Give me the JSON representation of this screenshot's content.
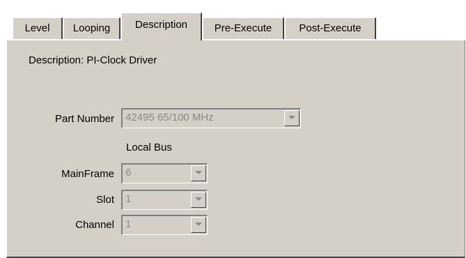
{
  "tabs": [
    {
      "label": "Level",
      "active": false
    },
    {
      "label": "Looping",
      "active": false
    },
    {
      "label": "Description",
      "active": true
    },
    {
      "label": "Pre-Execute",
      "active": false
    },
    {
      "label": "Post-Execute",
      "active": false
    }
  ],
  "description": {
    "label": "Description:",
    "value": "PI-Clock Driver"
  },
  "part_number": {
    "label": "Part Number",
    "value": "42495 65/100 MHz"
  },
  "local_bus": {
    "heading": "Local Bus",
    "mainframe": {
      "label": "MainFrame",
      "value": "6"
    },
    "slot": {
      "label": "Slot",
      "value": "1"
    },
    "channel": {
      "label": "Channel",
      "value": "1"
    }
  },
  "icons": {
    "dropdown": "chevron-down-icon"
  },
  "colors": {
    "face": "#d4d0c8",
    "disabled_text": "#8a8a8a"
  }
}
